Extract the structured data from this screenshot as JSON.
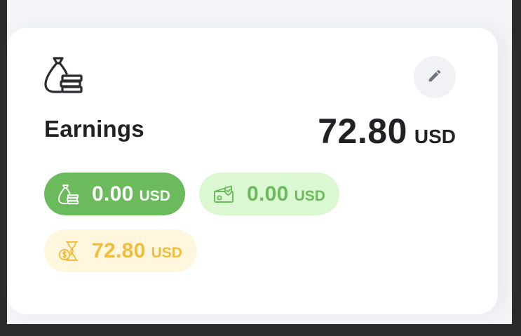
{
  "earnings": {
    "title": "Earnings",
    "total_amount": "72.80",
    "total_currency": "USD",
    "icon": "money-bag-coins-icon",
    "edit_icon": "pencil-icon"
  },
  "pills": [
    {
      "icon": "money-bag-coins-icon",
      "amount": "0.00",
      "currency": "USD",
      "background": "#6bbb5c",
      "text_color": "#ffffff"
    },
    {
      "icon": "cash-shield-icon",
      "amount": "0.00",
      "currency": "USD",
      "background": "#dcf8d2",
      "text_color": "#6bbb5c"
    },
    {
      "icon": "hourglass-coin-icon",
      "amount": "72.80",
      "currency": "USD",
      "background": "#fff7dd",
      "text_color": "#f2bc3c"
    }
  ]
}
